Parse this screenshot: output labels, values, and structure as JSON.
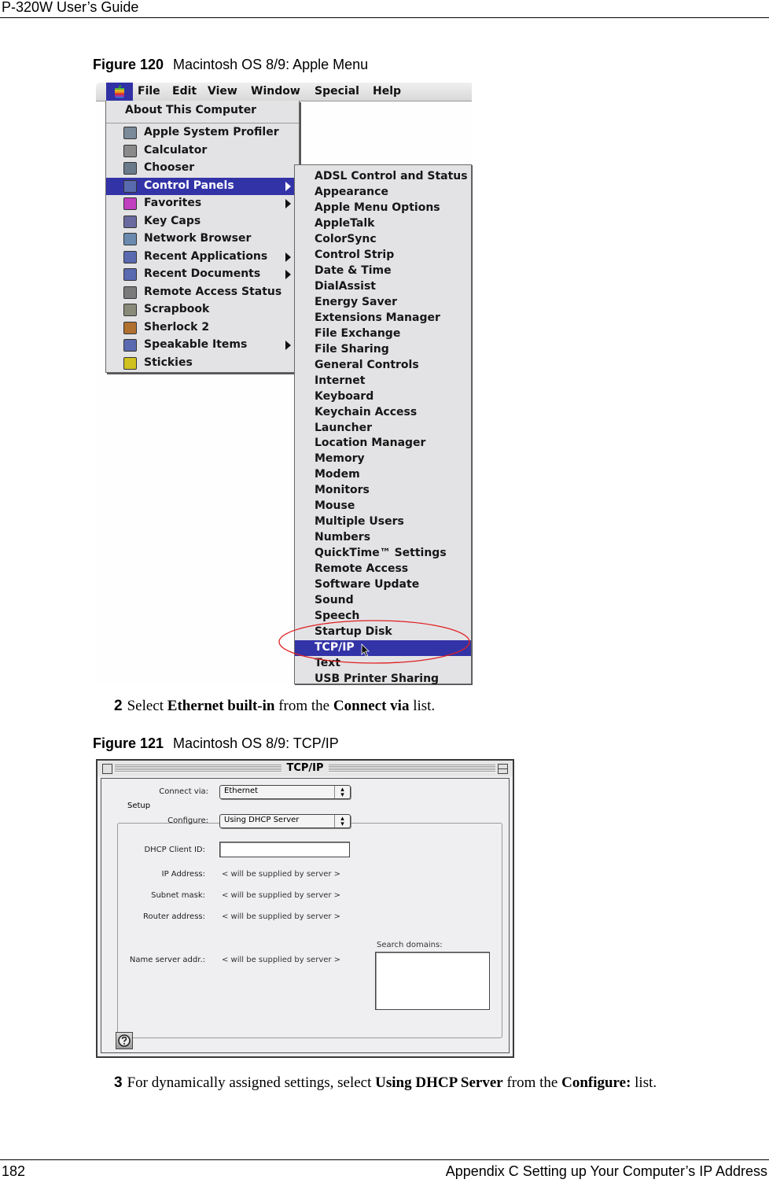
{
  "page": {
    "header": "P-320W User’s Guide",
    "footer_page_number": "182",
    "footer_title": "Appendix C Setting up Your Computer’s IP Address"
  },
  "figure120": {
    "label": "Figure 120",
    "caption": "Macintosh OS 8/9: Apple Menu",
    "menubar": {
      "apple_icon": "apple-logo-icon",
      "items": [
        "File",
        "Edit",
        "View",
        "Window",
        "Special",
        "Help"
      ]
    },
    "apple_menu": {
      "about": "About This Computer",
      "items": [
        {
          "label": "Apple System Profiler",
          "icon": "profiler-icon",
          "submenu": false,
          "selected": false
        },
        {
          "label": "Calculator",
          "icon": "calculator-icon",
          "submenu": false,
          "selected": false
        },
        {
          "label": "Chooser",
          "icon": "chooser-icon",
          "submenu": false,
          "selected": false
        },
        {
          "label": "Control Panels",
          "icon": "control-panels-folder-icon",
          "submenu": true,
          "selected": true
        },
        {
          "label": "Favorites",
          "icon": "favorites-folder-icon",
          "submenu": true,
          "selected": false
        },
        {
          "label": "Key Caps",
          "icon": "key-caps-icon",
          "submenu": false,
          "selected": false
        },
        {
          "label": "Network Browser",
          "icon": "network-browser-icon",
          "submenu": false,
          "selected": false
        },
        {
          "label": "Recent Applications",
          "icon": "recent-apps-folder-icon",
          "submenu": true,
          "selected": false
        },
        {
          "label": "Recent Documents",
          "icon": "recent-docs-folder-icon",
          "submenu": true,
          "selected": false
        },
        {
          "label": "Remote Access Status",
          "icon": "remote-access-icon",
          "submenu": false,
          "selected": false
        },
        {
          "label": "Scrapbook",
          "icon": "scrapbook-icon",
          "submenu": false,
          "selected": false
        },
        {
          "label": "Sherlock 2",
          "icon": "sherlock-magnifier-icon",
          "submenu": false,
          "selected": false
        },
        {
          "label": "Speakable Items",
          "icon": "speakable-items-folder-icon",
          "submenu": true,
          "selected": false
        },
        {
          "label": "Stickies",
          "icon": "stickies-icon",
          "submenu": false,
          "selected": false
        }
      ]
    },
    "control_panels_menu": {
      "items": [
        "ADSL Control and Status",
        "Appearance",
        "Apple Menu Options",
        "AppleTalk",
        "ColorSync",
        "Control Strip",
        "Date & Time",
        "DialAssist",
        "Energy Saver",
        "Extensions Manager",
        "File Exchange",
        "File Sharing",
        "General Controls",
        "Internet",
        "Keyboard",
        "Keychain Access",
        "Launcher",
        "Location Manager",
        "Memory",
        "Modem",
        "Monitors",
        "Mouse",
        "Multiple Users",
        "Numbers",
        "QuickTime™ Settings",
        "Remote Access",
        "Software Update",
        "Sound",
        "Speech",
        "Startup Disk",
        "TCP/IP",
        "Text",
        "USB Printer Sharing"
      ],
      "selected": "TCP/IP",
      "highlight_color": "#3333a8",
      "annotation_color": "#e02020"
    }
  },
  "step2": {
    "number": "2",
    "parts": [
      {
        "text": "Select ",
        "bold": false
      },
      {
        "text": "Ethernet built-in",
        "bold": true
      },
      {
        "text": " from the ",
        "bold": false
      },
      {
        "text": "Connect via",
        "bold": true
      },
      {
        "text": " list.",
        "bold": false
      }
    ]
  },
  "figure121": {
    "label": "Figure 121",
    "caption": "Macintosh OS 8/9: TCP/IP",
    "window": {
      "title": "TCP/IP",
      "connect_via_label": "Connect via:",
      "connect_via_value": "Ethernet",
      "setup_group_label": "Setup",
      "configure_label": "Configure:",
      "configure_value": "Using DHCP Server",
      "dhcp_client_id_label": "DHCP Client ID:",
      "dhcp_client_id_value": "",
      "ip_address_label": "IP Address:",
      "ip_address_value": "< will be supplied by server >",
      "subnet_mask_label": "Subnet mask:",
      "subnet_mask_value": "< will be supplied by server >",
      "router_address_label": "Router address:",
      "router_address_value": "< will be supplied by server >",
      "name_server_label": "Name server addr.:",
      "name_server_value": "< will be supplied by server >",
      "search_domains_label": "Search domains:",
      "search_domains_value": "",
      "help_icon": "help-question-icon"
    }
  },
  "step3": {
    "number": "3",
    "parts": [
      {
        "text": "For dynamically assigned settings, select ",
        "bold": false
      },
      {
        "text": "Using DHCP Server",
        "bold": true
      },
      {
        "text": " from the ",
        "bold": false
      },
      {
        "text": "Configure:",
        "bold": true
      },
      {
        "text": " list.",
        "bold": false
      }
    ]
  }
}
